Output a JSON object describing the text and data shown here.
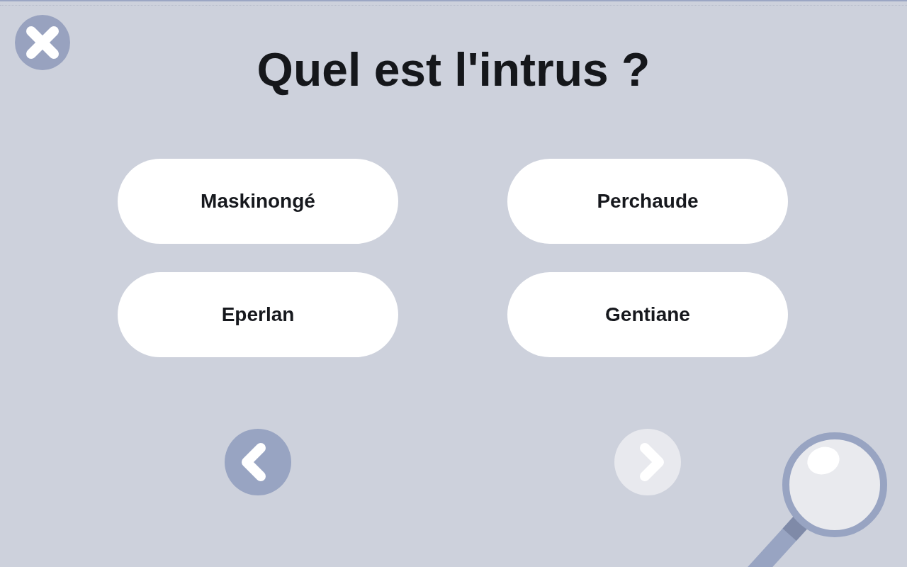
{
  "title": "Quel est l'intrus ?",
  "answers": [
    {
      "label": "Maskinongé",
      "selected": false
    },
    {
      "label": "Perchaude",
      "selected": false
    },
    {
      "label": "Eperlan",
      "selected": false
    },
    {
      "label": "Gentiane",
      "selected": false
    }
  ],
  "navigation": [
    {
      "kind": "previous",
      "disabled": false
    },
    {
      "kind": "next",
      "disabled": true
    }
  ]
}
